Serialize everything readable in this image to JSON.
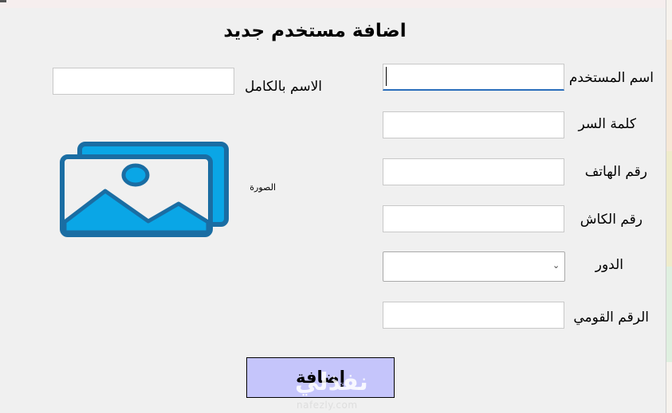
{
  "form": {
    "title": "اضافة مستخدم جديد",
    "labels": {
      "username": "اسم المستخدم",
      "password": "كلمة السر",
      "phone": "رقم الهاتف",
      "cash_number": "رقم الكاش",
      "role": "الدور",
      "national_id": "الرقم القومي",
      "full_name": "الاسم بالكامل",
      "photo": "الصورة"
    },
    "values": {
      "username": "",
      "password": "",
      "phone": "",
      "cash_number": "",
      "role": "",
      "national_id": "",
      "full_name": ""
    },
    "add_button_label": "إضافة"
  },
  "watermark": {
    "text": "نفذلي",
    "url": "nafezly.com"
  },
  "icons": {
    "photo": "image-placeholder-icon",
    "dropdown": "chevron-down-icon"
  },
  "colors": {
    "background": "#f0f0f0",
    "button_bg": "#c5c5fb",
    "icon_blue": "#0aa6e6",
    "icon_frame": "#1a6da3",
    "focus_underline": "#2a6ebb"
  }
}
